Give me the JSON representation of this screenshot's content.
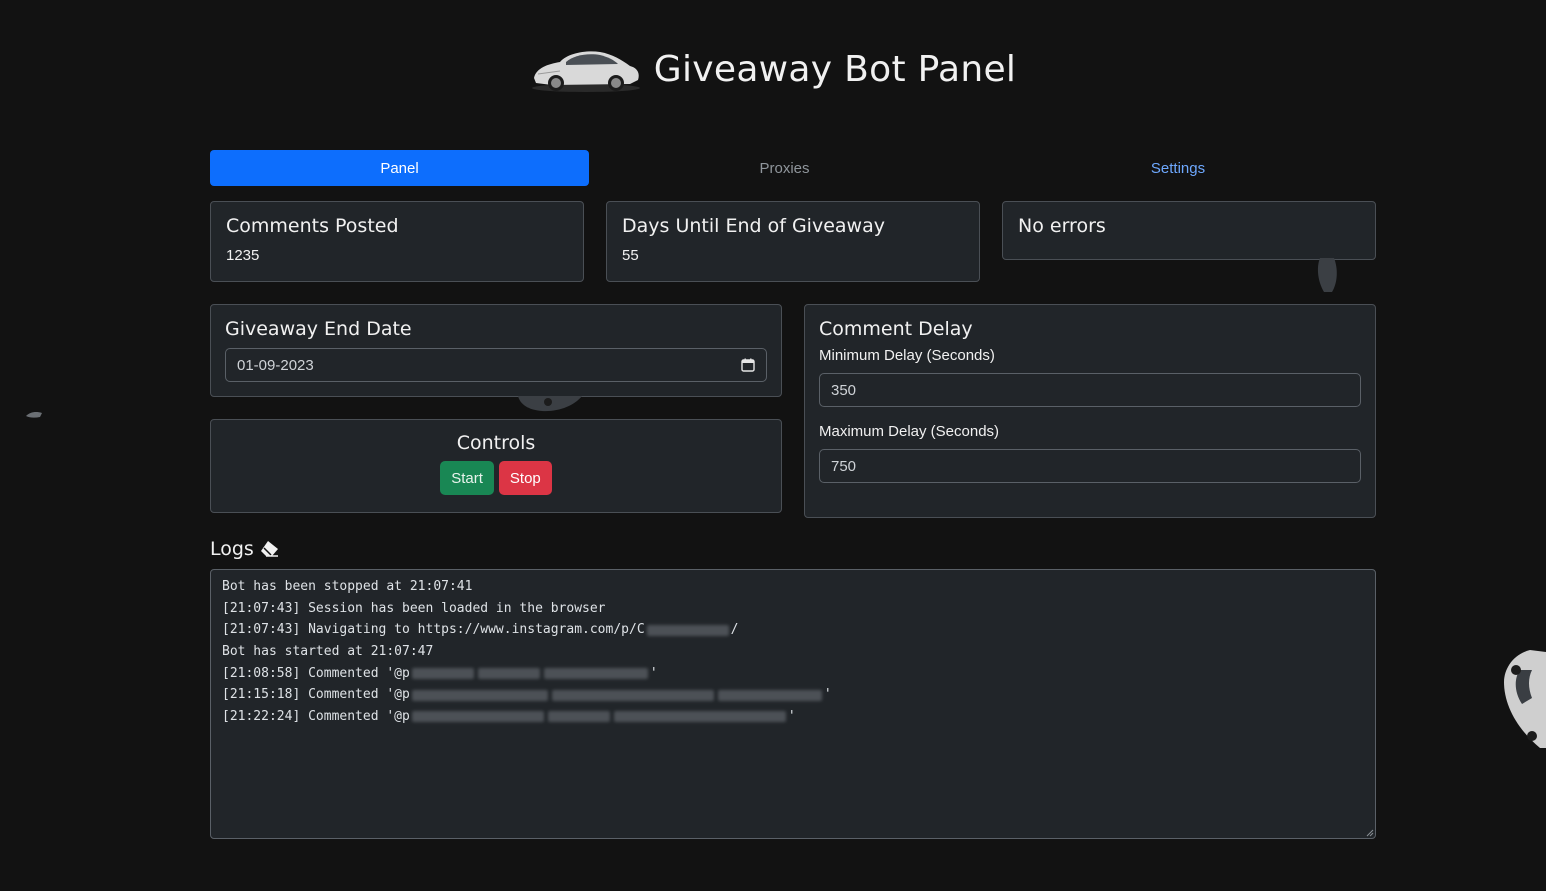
{
  "header": {
    "title": "Giveaway Bot Panel",
    "logo": "car-logo-icon"
  },
  "tabs": [
    {
      "label": "Panel",
      "active": true
    },
    {
      "label": "Proxies",
      "active": false
    },
    {
      "label": "Settings",
      "active": false
    }
  ],
  "stats": {
    "comments": {
      "title": "Comments Posted",
      "value": "1235"
    },
    "days": {
      "title": "Days Until End of Giveaway",
      "value": "55"
    },
    "errors": {
      "title": "No errors"
    }
  },
  "end_date": {
    "title": "Giveaway End Date",
    "value": "01-09-2023",
    "icon": "calendar-icon"
  },
  "delay": {
    "title": "Comment Delay",
    "min_label": "Minimum Delay (Seconds)",
    "min_value": "350",
    "max_label": "Maximum Delay (Seconds)",
    "max_value": "750"
  },
  "controls": {
    "title": "Controls",
    "start": "Start",
    "stop": "Stop"
  },
  "logs": {
    "title": "Logs",
    "clear_icon": "eraser-icon",
    "lines": [
      "Bot has been stopped at 21:07:41",
      "[21:07:43] Session has been loaded in the browser",
      "[21:07:43] Navigating to https://www.instagram.com/p/C",
      "Bot has started at 21:07:47",
      "[21:08:58] Commented '@p",
      "[21:15:18] Commented '@p",
      "[21:22:24] Commented '@p"
    ]
  },
  "colors": {
    "accent": "#0d6efd",
    "start": "#198754",
    "stop": "#dc3545",
    "link": "#6ea8fe",
    "background": "#121212",
    "card": "#212529"
  }
}
